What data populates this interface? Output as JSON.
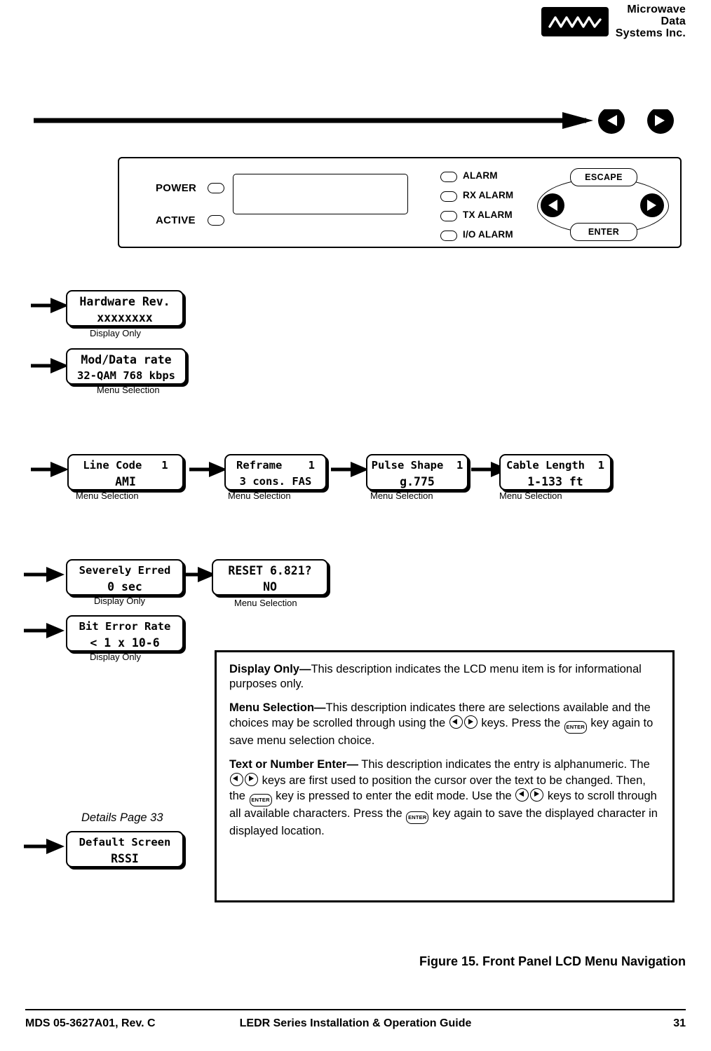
{
  "logo": {
    "line1": "Microwave",
    "line2": "Data",
    "line3": "Systems Inc.",
    "mark": "mds-wave-logo"
  },
  "front_panel": {
    "power_label": "POWER",
    "active_label": "ACTIVE",
    "alarms": [
      "ALARM",
      "RX ALARM",
      "TX ALARM",
      "I/O ALARM"
    ],
    "keys": {
      "escape": "ESCAPE",
      "enter": "ENTER",
      "left": "left-arrow-key",
      "right": "right-arrow-key"
    }
  },
  "menu_items": [
    {
      "line1": "Hardware Rev.",
      "line2": "xxxxxxxx",
      "caption": "Display Only"
    },
    {
      "line1": "Mod/Data rate",
      "line2": "32-QAM 768 kbps",
      "caption": "Menu Selection"
    },
    {
      "line1": "Line Code   1",
      "line2": "AMI",
      "caption": "Menu Selection"
    },
    {
      "line1": "Reframe    1",
      "line2": "3 cons. FAS",
      "caption": "Menu Selection"
    },
    {
      "line1": "Pulse Shape  1",
      "line2": "g.775",
      "caption": "Menu Selection"
    },
    {
      "line1": "Cable Length  1",
      "line2": "1-133 ft",
      "caption": "Menu Selection"
    },
    {
      "line1": "Severely Erred",
      "line2": "0 sec",
      "caption": "Display Only"
    },
    {
      "line1": "RESET 6.821?",
      "line2": "NO",
      "caption": "Menu Selection"
    },
    {
      "line1": "Bit Error Rate",
      "line2": "< 1 x 10-6",
      "caption": "Display Only"
    },
    {
      "line1": "Default Screen",
      "line2": "RSSI",
      "caption": ""
    }
  ],
  "details_note": "Details Page 33",
  "legend": {
    "display_only_title": "Display Only—",
    "display_only_text": "This description indicates the LCD menu item is for informational purposes only.",
    "menu_selection_title": "Menu Selection—",
    "menu_selection_text_a": "This description indicates there are selections available and the choices may be scrolled through using the ",
    "menu_selection_text_b": " keys. Press the ",
    "menu_selection_text_c": " key again to save menu selection choice.",
    "text_enter_title": "Text or Number Enter—",
    "text_enter_a": " This description indicates the entry is alphanumeric. The ",
    "text_enter_b": " keys are first used to position the cursor over the text to be changed. Then, the ",
    "text_enter_c": " key is pressed to enter the edit mode. Use the ",
    "text_enter_d": " keys to scroll through all available characters. Press the ",
    "text_enter_e": " key again to save the displayed character in displayed location.",
    "enter_key_label": "ENTER"
  },
  "figure_caption": "Figure 15. Front Panel LCD Menu Navigation",
  "footer": {
    "left": "MDS 05-3627A01, Rev. C",
    "center": "LEDR Series Installation & Operation Guide",
    "right": "31"
  }
}
